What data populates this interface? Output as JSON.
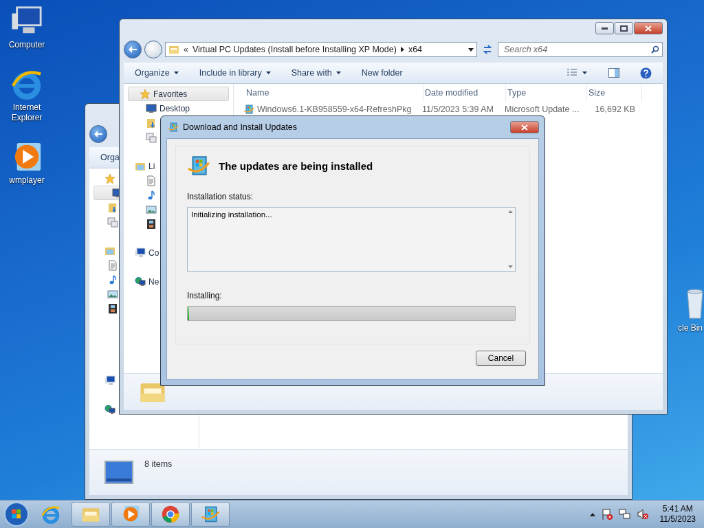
{
  "desktop_icons": [
    {
      "label": "Computer",
      "kind": "computer"
    },
    {
      "label": "Internet Explorer",
      "kind": "ie"
    },
    {
      "label": "wmplayer",
      "kind": "wmp"
    }
  ],
  "recycle_bin": {
    "label": "cle Bin"
  },
  "back_window": {
    "toolbar": [
      "Orga"
    ],
    "sidebar": [
      {
        "kind": "star",
        "selected": false
      },
      {
        "kind": "desktop",
        "selected": true
      },
      {
        "kind": "downloads",
        "selected": false
      },
      {
        "kind": "recent",
        "selected": false
      },
      {
        "kind": "gap"
      },
      {
        "kind": "libraries",
        "selected": false
      },
      {
        "kind": "documents",
        "selected": false
      },
      {
        "kind": "music",
        "selected": false
      },
      {
        "kind": "pictures",
        "selected": false
      },
      {
        "kind": "videos",
        "selected": false
      },
      {
        "kind": "gap"
      },
      {
        "kind": "gap"
      },
      {
        "kind": "gap"
      },
      {
        "kind": "gap"
      },
      {
        "kind": "computer",
        "selected": false
      },
      {
        "kind": "gap"
      },
      {
        "kind": "network",
        "selected": false
      }
    ],
    "status": "8 items"
  },
  "explorer": {
    "address_prefix": "«",
    "address": [
      "Virtual PC Updates (Install before Installing XP Mode)",
      "x64"
    ],
    "search": {
      "placeholder": "Search x64"
    },
    "toolbar": [
      {
        "label": "Organize",
        "dropdown": true
      },
      {
        "label": "Include in library",
        "dropdown": true
      },
      {
        "label": "Share with",
        "dropdown": true
      },
      {
        "label": "New folder",
        "dropdown": false
      }
    ],
    "sidebar": [
      {
        "label": "Favorites",
        "kind": "star",
        "header": true
      },
      {
        "label": "Desktop",
        "kind": "desktop"
      },
      {
        "kind": "downloads"
      },
      {
        "kind": "recent"
      },
      {
        "kind": "gap"
      },
      {
        "label": "Li",
        "kind": "libraries"
      },
      {
        "kind": "documents"
      },
      {
        "kind": "music"
      },
      {
        "kind": "pictures"
      },
      {
        "kind": "videos"
      },
      {
        "kind": "gap"
      },
      {
        "label": "Co",
        "kind": "computer"
      },
      {
        "kind": "gap"
      },
      {
        "label": "Ne",
        "kind": "network"
      }
    ],
    "columns": [
      "Name",
      "Date modified",
      "Type",
      "Size"
    ],
    "rows": [
      {
        "name": "Windows6.1-KB958559-x64-RefreshPkg",
        "date": "11/5/2023 5:39 AM",
        "type": "Microsoft Update ...",
        "size": "16,692 KB"
      }
    ]
  },
  "dialog": {
    "title": "Download and Install Updates",
    "heading": "The updates are being installed",
    "status_label": "Installation status:",
    "status_text": "Initializing installation...",
    "progress_label": "Installing:",
    "progress": {
      "level": 0
    },
    "buttons": [
      "Cancel"
    ]
  },
  "taskbar": {
    "items": [
      {
        "kind": "ie",
        "running": false
      },
      {
        "kind": "explorer",
        "running": true
      },
      {
        "kind": "wmp",
        "running": true
      },
      {
        "kind": "chrome",
        "running": true
      },
      {
        "kind": "updates",
        "running": true
      }
    ],
    "time": "5:41 AM",
    "date": "11/5/2023"
  }
}
